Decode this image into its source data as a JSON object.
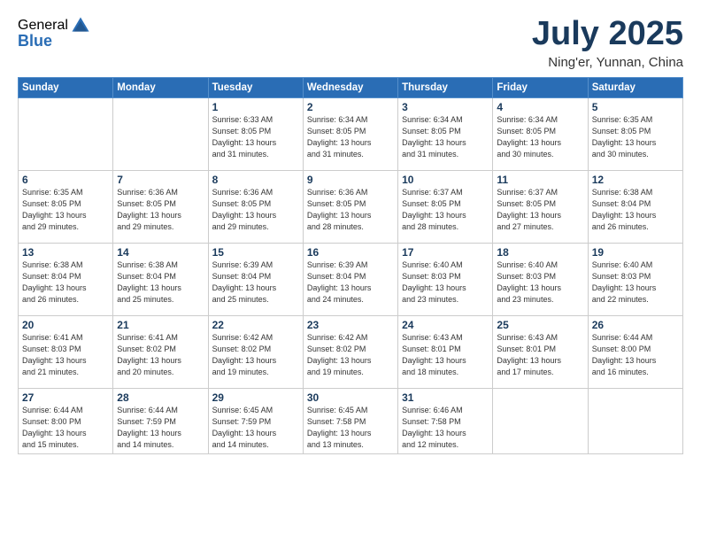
{
  "logo": {
    "general": "General",
    "blue": "Blue"
  },
  "title": "July 2025",
  "location": "Ning'er, Yunnan, China",
  "weekdays": [
    "Sunday",
    "Monday",
    "Tuesday",
    "Wednesday",
    "Thursday",
    "Friday",
    "Saturday"
  ],
  "weeks": [
    [
      {
        "day": "",
        "info": ""
      },
      {
        "day": "",
        "info": ""
      },
      {
        "day": "1",
        "info": "Sunrise: 6:33 AM\nSunset: 8:05 PM\nDaylight: 13 hours\nand 31 minutes."
      },
      {
        "day": "2",
        "info": "Sunrise: 6:34 AM\nSunset: 8:05 PM\nDaylight: 13 hours\nand 31 minutes."
      },
      {
        "day": "3",
        "info": "Sunrise: 6:34 AM\nSunset: 8:05 PM\nDaylight: 13 hours\nand 31 minutes."
      },
      {
        "day": "4",
        "info": "Sunrise: 6:34 AM\nSunset: 8:05 PM\nDaylight: 13 hours\nand 30 minutes."
      },
      {
        "day": "5",
        "info": "Sunrise: 6:35 AM\nSunset: 8:05 PM\nDaylight: 13 hours\nand 30 minutes."
      }
    ],
    [
      {
        "day": "6",
        "info": "Sunrise: 6:35 AM\nSunset: 8:05 PM\nDaylight: 13 hours\nand 29 minutes."
      },
      {
        "day": "7",
        "info": "Sunrise: 6:36 AM\nSunset: 8:05 PM\nDaylight: 13 hours\nand 29 minutes."
      },
      {
        "day": "8",
        "info": "Sunrise: 6:36 AM\nSunset: 8:05 PM\nDaylight: 13 hours\nand 29 minutes."
      },
      {
        "day": "9",
        "info": "Sunrise: 6:36 AM\nSunset: 8:05 PM\nDaylight: 13 hours\nand 28 minutes."
      },
      {
        "day": "10",
        "info": "Sunrise: 6:37 AM\nSunset: 8:05 PM\nDaylight: 13 hours\nand 28 minutes."
      },
      {
        "day": "11",
        "info": "Sunrise: 6:37 AM\nSunset: 8:05 PM\nDaylight: 13 hours\nand 27 minutes."
      },
      {
        "day": "12",
        "info": "Sunrise: 6:38 AM\nSunset: 8:04 PM\nDaylight: 13 hours\nand 26 minutes."
      }
    ],
    [
      {
        "day": "13",
        "info": "Sunrise: 6:38 AM\nSunset: 8:04 PM\nDaylight: 13 hours\nand 26 minutes."
      },
      {
        "day": "14",
        "info": "Sunrise: 6:38 AM\nSunset: 8:04 PM\nDaylight: 13 hours\nand 25 minutes."
      },
      {
        "day": "15",
        "info": "Sunrise: 6:39 AM\nSunset: 8:04 PM\nDaylight: 13 hours\nand 25 minutes."
      },
      {
        "day": "16",
        "info": "Sunrise: 6:39 AM\nSunset: 8:04 PM\nDaylight: 13 hours\nand 24 minutes."
      },
      {
        "day": "17",
        "info": "Sunrise: 6:40 AM\nSunset: 8:03 PM\nDaylight: 13 hours\nand 23 minutes."
      },
      {
        "day": "18",
        "info": "Sunrise: 6:40 AM\nSunset: 8:03 PM\nDaylight: 13 hours\nand 23 minutes."
      },
      {
        "day": "19",
        "info": "Sunrise: 6:40 AM\nSunset: 8:03 PM\nDaylight: 13 hours\nand 22 minutes."
      }
    ],
    [
      {
        "day": "20",
        "info": "Sunrise: 6:41 AM\nSunset: 8:03 PM\nDaylight: 13 hours\nand 21 minutes."
      },
      {
        "day": "21",
        "info": "Sunrise: 6:41 AM\nSunset: 8:02 PM\nDaylight: 13 hours\nand 20 minutes."
      },
      {
        "day": "22",
        "info": "Sunrise: 6:42 AM\nSunset: 8:02 PM\nDaylight: 13 hours\nand 19 minutes."
      },
      {
        "day": "23",
        "info": "Sunrise: 6:42 AM\nSunset: 8:02 PM\nDaylight: 13 hours\nand 19 minutes."
      },
      {
        "day": "24",
        "info": "Sunrise: 6:43 AM\nSunset: 8:01 PM\nDaylight: 13 hours\nand 18 minutes."
      },
      {
        "day": "25",
        "info": "Sunrise: 6:43 AM\nSunset: 8:01 PM\nDaylight: 13 hours\nand 17 minutes."
      },
      {
        "day": "26",
        "info": "Sunrise: 6:44 AM\nSunset: 8:00 PM\nDaylight: 13 hours\nand 16 minutes."
      }
    ],
    [
      {
        "day": "27",
        "info": "Sunrise: 6:44 AM\nSunset: 8:00 PM\nDaylight: 13 hours\nand 15 minutes."
      },
      {
        "day": "28",
        "info": "Sunrise: 6:44 AM\nSunset: 7:59 PM\nDaylight: 13 hours\nand 14 minutes."
      },
      {
        "day": "29",
        "info": "Sunrise: 6:45 AM\nSunset: 7:59 PM\nDaylight: 13 hours\nand 14 minutes."
      },
      {
        "day": "30",
        "info": "Sunrise: 6:45 AM\nSunset: 7:58 PM\nDaylight: 13 hours\nand 13 minutes."
      },
      {
        "day": "31",
        "info": "Sunrise: 6:46 AM\nSunset: 7:58 PM\nDaylight: 13 hours\nand 12 minutes."
      },
      {
        "day": "",
        "info": ""
      },
      {
        "day": "",
        "info": ""
      }
    ]
  ]
}
